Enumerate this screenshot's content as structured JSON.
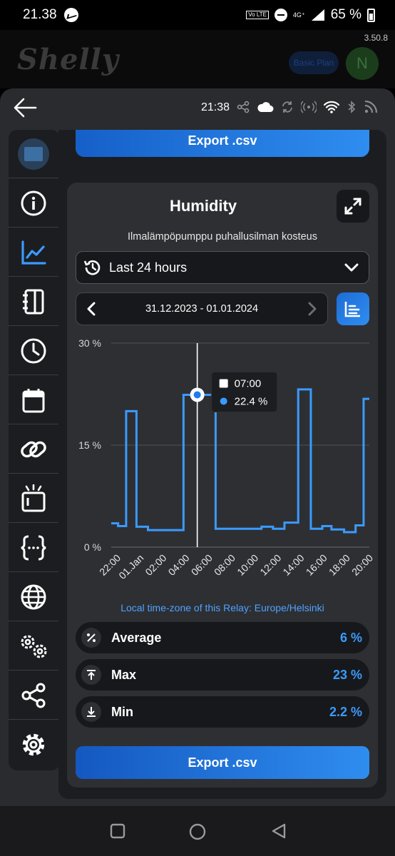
{
  "status_bar": {
    "time": "21.38",
    "network_label": "4G⁺",
    "lte_label": "Vo LTE",
    "battery": "65 %"
  },
  "app_header": {
    "logo": "Shelly",
    "version": "3.50.8",
    "plan": "Basic Plan",
    "avatar_initial": "N"
  },
  "device_bar": {
    "time": "21:38"
  },
  "top_export_label": "Export .csv",
  "card": {
    "title": "Humidity",
    "subtitle": "Ilmalämpöpumppu puhallusilman kosteus",
    "period": "Last 24 hours",
    "date_range": "31.12.2023 - 01.01.2024",
    "timezone_note": "Local time-zone of this Relay: Europe/Helsinki",
    "tooltip_time": "07:00",
    "tooltip_value": "22.4 %",
    "stats": [
      {
        "name": "Average",
        "value": "6 %",
        "icon": "percent-icon"
      },
      {
        "name": "Max",
        "value": "23 %",
        "icon": "arrow-up-bar-icon"
      },
      {
        "name": "Min",
        "value": "2.2 %",
        "icon": "arrow-down-bar-icon"
      }
    ],
    "export_label": "Export .csv"
  },
  "colors": {
    "accent": "#2f8df0",
    "line": "#3a9bff",
    "panel": "#2e2f33",
    "background": "#1c1d20"
  },
  "chart_data": {
    "type": "line",
    "title": "",
    "xlabel": "",
    "ylabel": "",
    "ylim": [
      0,
      30
    ],
    "y_ticks": [
      "0 %",
      "15 %",
      "30 %"
    ],
    "y_tick_values": [
      0,
      15,
      30
    ],
    "x_ticks": [
      "22:00",
      "01.Jan",
      "02:00",
      "04:00",
      "06:00",
      "08:00",
      "10:00",
      "12:00",
      "14:00",
      "16:00",
      "18:00",
      "20:00"
    ],
    "x_tick_hours": [
      0,
      2,
      4,
      6,
      8,
      10,
      12,
      14,
      16,
      18,
      20,
      22
    ],
    "step": true,
    "series": [
      {
        "x": [
          -0.5,
          0.1,
          0.8,
          1.7,
          2.7,
          4.3,
          5.8,
          8.6,
          8.9,
          12.6,
          13.6,
          14.6,
          15.8,
          16.9,
          17.9,
          18.7,
          19.8,
          20.8,
          21.5
        ],
        "y": [
          3.5,
          3.1,
          20.0,
          3.0,
          2.5,
          2.5,
          22.4,
          2.7,
          2.7,
          3.0,
          2.7,
          3.6,
          23.2,
          2.7,
          3.1,
          2.6,
          2.2,
          3.2,
          21.8
        ]
      }
    ],
    "grid": true,
    "cursor_x": 7.0
  }
}
